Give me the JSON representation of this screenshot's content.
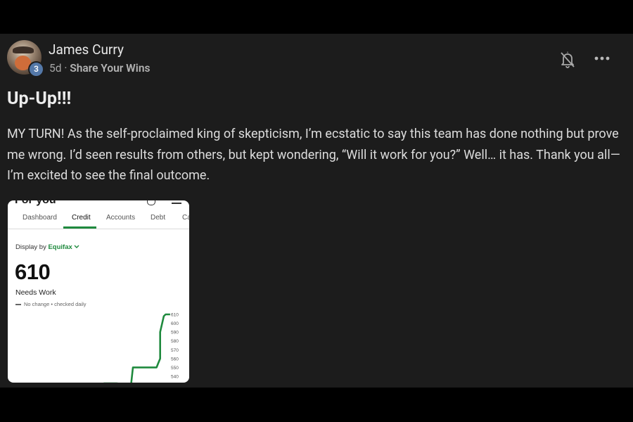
{
  "post": {
    "author": "James Curry",
    "level": "3",
    "age": "5d",
    "separator": "·",
    "category": "Share Your Wins",
    "title": "Up-Up!!!",
    "body": "MY TURN! As the self-proclaimed king of skepticism, I’m ecstatic to say this team has done nothing but prove me wrong. I’d seen results from others, but kept wondering, “Will it work for you?” Well… it has. Thank you all—I’m excited to see the final outcome."
  },
  "icons": {
    "bell": "bell-off-icon",
    "more": "more-horizontal-icon"
  },
  "screenshot": {
    "heading": "For you",
    "tabs": [
      "Dashboard",
      "Credit",
      "Accounts",
      "Debt",
      "Ca"
    ],
    "active_tab": "Credit",
    "display_by_label": "Display by",
    "bureau": "Equifax",
    "score": "610",
    "rating": "Needs Work",
    "change_note": "No change • checked daily",
    "accent_color": "#1f8a3e"
  },
  "chart_data": {
    "type": "line",
    "y_ticks": [
      "610",
      "600",
      "590",
      "580",
      "570",
      "560",
      "550",
      "540"
    ],
    "ylim": [
      530,
      612
    ],
    "series": [
      {
        "points": [
          [
            0.52,
            530
          ],
          [
            0.53,
            532
          ],
          [
            0.6,
            532
          ],
          [
            0.66,
            531
          ],
          [
            0.68,
            531
          ],
          [
            0.69,
            550
          ],
          [
            0.82,
            550
          ],
          [
            0.83,
            555
          ],
          [
            0.84,
            560
          ],
          [
            0.84,
            590
          ],
          [
            0.86,
            608
          ],
          [
            0.87,
            610
          ],
          [
            0.895,
            610
          ]
        ]
      }
    ]
  }
}
